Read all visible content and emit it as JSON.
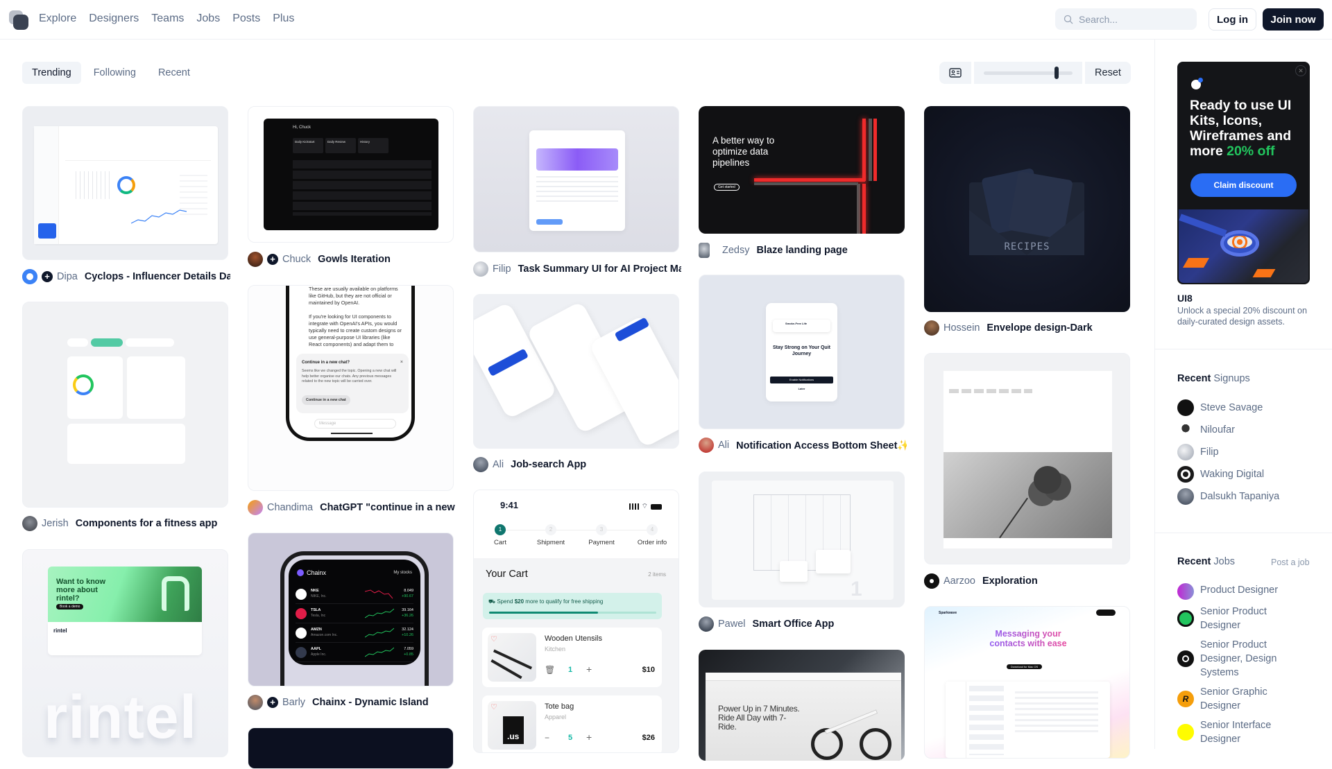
{
  "header": {
    "nav": [
      "Explore",
      "Designers",
      "Teams",
      "Jobs",
      "Posts",
      "Plus"
    ],
    "search_placeholder": "Search...",
    "login_label": "Log in",
    "join_label": "Join now"
  },
  "feed_tabs": {
    "items": [
      "Trending",
      "Following",
      "Recent"
    ],
    "active": "Trending"
  },
  "view_controls": {
    "layout_icon": "profile-card-icon",
    "zoom_slider_value": 0.82,
    "reset_label": "Reset"
  },
  "shots": [
    {
      "author": "Dipa",
      "title": "Cyclops - Influencer Details Da",
      "has_follow": true
    },
    {
      "author": "Jerish",
      "title": "Components for a fitness app",
      "has_follow": false
    },
    {
      "author": "",
      "title": "",
      "has_follow": false
    },
    {
      "author": "Chuck",
      "title": "Gowls Iteration",
      "has_follow": true
    },
    {
      "author": "Chandima",
      "title": "ChatGPT \"continue in a new",
      "has_follow": false
    },
    {
      "author": "Barly",
      "title": "Chainx - Dynamic Island",
      "has_follow": true
    },
    {
      "author": "Filip",
      "title": "Task Summary UI for AI Project Ma",
      "has_follow": false
    },
    {
      "author": "Ali",
      "title": "Job-search App",
      "has_follow": false
    },
    {
      "author": "Zedsy",
      "title": "Blaze landing page",
      "has_follow": false
    },
    {
      "author": "Ali",
      "title": "Notification Access Bottom Sheet✨",
      "has_follow": false
    },
    {
      "author": "Pawel",
      "title": "Smart Office App",
      "has_follow": false
    },
    {
      "author": "Hossein",
      "title": "Envelope design-Dark",
      "has_follow": false
    },
    {
      "author": "Aarzoo",
      "title": "Exploration",
      "has_follow": false
    }
  ],
  "shot_content": {
    "gowls_greeting": "Hi, Chuck",
    "gowls_tiles": [
      "Daily Kickstart",
      "Daily Review",
      "History"
    ],
    "chatgpt": {
      "body": "These are usually available on platforms like GitHub, but they are not official or maintained by OpenAI.\n\nIf you're looking for UI components to integrate with OpenAI's APIs, you would typically need to create custom designs or use general-purpose UI libraries (like React components) and adapt them to",
      "dialog_title": "Continue in a new chat?",
      "dialog_body": "Seems like we changed the topic. Opening a new chat will help better organise our chats. Any previous messages related to the new topic will be carried over.",
      "dialog_button": "Continue in a new chat",
      "input_placeholder": "Message"
    },
    "chainx": {
      "brand": "Chainx",
      "tab": "My stocks",
      "stocks": [
        {
          "ticker": "NKE",
          "name": "NIKE, Inc.",
          "price": "8.049",
          "change": "+90.67"
        },
        {
          "ticker": "TSLA",
          "name": "Tesla, Inc",
          "price": "39.164",
          "change": "+36.26"
        },
        {
          "ticker": "AMZN",
          "name": "Amazon.com Inc.",
          "price": "32.124",
          "change": "+10.26"
        },
        {
          "ticker": "AAPL",
          "name": "Apple Inc.",
          "price": "7.059",
          "change": "+0.85"
        }
      ]
    },
    "cart": {
      "time": "9:41",
      "steps": [
        {
          "num": "1",
          "label": "Cart"
        },
        {
          "num": "2",
          "label": "Shipment"
        },
        {
          "num": "3",
          "label": "Payment"
        },
        {
          "num": "4",
          "label": "Order info"
        }
      ],
      "title": "Your Cart",
      "count": "2 items",
      "shipping_pre": "Spend",
      "shipping_amount": "$20",
      "shipping_post": "more to qualify for free shipping",
      "shipping_progress": 0.65,
      "items": [
        {
          "name": "Wooden Utensils",
          "category": "Kitchen",
          "qty": "1",
          "price": "$10"
        },
        {
          "name": "Tote bag",
          "category": "Apparel",
          "qty": "5",
          "price": "$26"
        }
      ]
    },
    "blaze": {
      "headline": "A better way to optimize data pipelines",
      "cta": "Get started"
    },
    "notification_sheet": {
      "title": "Stay Strong on Your Quit Journey",
      "primary": "Enable Notifications",
      "secondary": "Later",
      "notif": "Smoke-Free Life"
    },
    "envelope_label": "RECIPES",
    "rintel": {
      "headline": "Want to know more about rintel?",
      "cta": "Book a demo",
      "brand": "rintel",
      "wordmark": "rintel"
    },
    "bike": {
      "headline": "Power Up in 7 Minutes. Ride All Day with 7-Ride."
    },
    "sparkwave": {
      "brand": "Sparkwave",
      "headline": "Messaging your contacts with ease",
      "download": "Download for Mac OS"
    }
  },
  "sidebar": {
    "promo": {
      "headline_main": "Ready to use UI Kits, Icons, Wireframes and more",
      "headline_highlight": "20% off",
      "button": "Claim discount",
      "title": "UI8",
      "description": "Unlock a special 20% discount on daily-curated design assets."
    },
    "signups": {
      "title_bold": "Recent",
      "title_light": "Signups",
      "items": [
        "Steve Savage",
        "Niloufar",
        "Filip",
        "Waking Digital",
        "Dalsukh Tapaniya"
      ]
    },
    "jobs": {
      "title_bold": "Recent",
      "title_light": "Jobs",
      "post_link": "Post a job",
      "items": [
        "Product Designer",
        "Senior Product Designer",
        "Senior Product Designer, Design Systems",
        "Senior Graphic Designer",
        "Senior Interface Designer"
      ]
    }
  }
}
